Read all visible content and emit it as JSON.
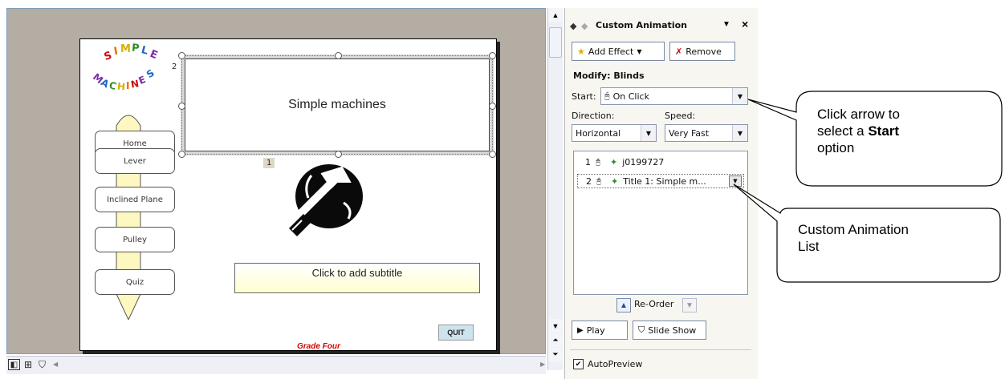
{
  "slide": {
    "logo_top": [
      "S",
      "I",
      "M",
      "P",
      "L",
      "E"
    ],
    "logo_bottom": [
      "M",
      "A",
      "C",
      "H",
      "I",
      "N",
      "E",
      "S"
    ],
    "title_order_tag": "2",
    "title": "Simple machines",
    "clipart_order_tag": "1",
    "nav_buttons": [
      "Home",
      "Lever",
      "Inclined Plane",
      "Pulley",
      "Quiz"
    ],
    "subtitle_placeholder": "Click to add subtitle",
    "quit": "QUIT",
    "footer": "Grade Four"
  },
  "task_pane": {
    "title": "Custom Animation",
    "add_effect": "Add Effect",
    "remove": "Remove",
    "modify_label": "Modify: Blinds",
    "start_label": "Start:",
    "start_value": "On Click",
    "direction_label": "Direction:",
    "direction_value": "Horizontal",
    "speed_label": "Speed:",
    "speed_value": "Very Fast",
    "list": [
      {
        "order": "1",
        "name": "j0199727"
      },
      {
        "order": "2",
        "name": "Title 1: Simple m..."
      }
    ],
    "reorder": "Re-Order",
    "play": "Play",
    "slide_show": "Slide Show",
    "autopreview": "AutoPreview"
  },
  "callouts": {
    "start_l1": "Click arrow to",
    "start_l2_pre": "select a ",
    "start_l2_bold": "Start",
    "start_l3": "option",
    "list_l1": "Custom Animation",
    "list_l2": "List"
  },
  "colors": {
    "canvas": "#b3ada3",
    "logo_letters": [
      "#c81010",
      "#e06f00",
      "#d4b000",
      "#2c8f2c",
      "#1f63c4",
      "#7a2fa8"
    ],
    "footer_red": "#d40000",
    "quit_bg": "#cde3ee"
  }
}
